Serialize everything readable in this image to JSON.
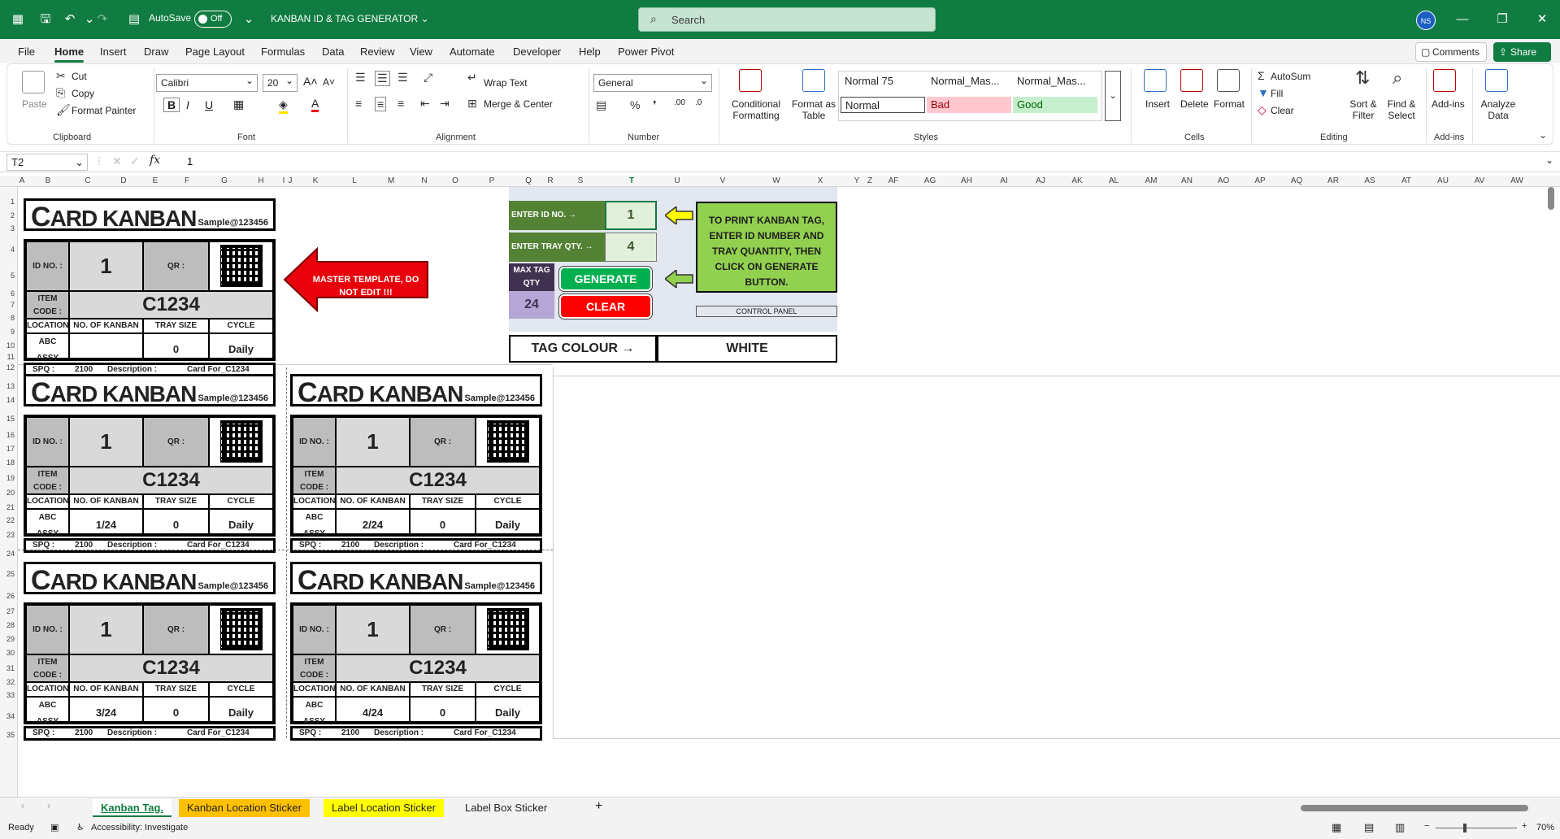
{
  "app": {
    "autosave_label": "AutoSave",
    "autosave_state": "Off",
    "doc_title": "KANBAN ID & TAG GENERATOR",
    "search_placeholder": "Search",
    "user_initials": "NS",
    "comments": "Comments",
    "share": "Share"
  },
  "menu": [
    "File",
    "Home",
    "Insert",
    "Draw",
    "Page Layout",
    "Formulas",
    "Data",
    "Review",
    "View",
    "Automate",
    "Developer",
    "Help",
    "Power Pivot"
  ],
  "ribbon": {
    "clipboard": {
      "paste": "Paste",
      "cut": "Cut",
      "copy": "Copy",
      "format_painter": "Format Painter",
      "group": "Clipboard"
    },
    "font": {
      "name": "Calibri",
      "size": "20",
      "group": "Font"
    },
    "alignment": {
      "wrap": "Wrap Text",
      "merge": "Merge & Center",
      "group": "Alignment"
    },
    "number": {
      "format": "General",
      "group": "Number"
    },
    "styles": {
      "conditional": "Conditional Formatting",
      "format_table": "Format as Table",
      "normal75": "Normal 75",
      "normal_mas1": "Normal_Mas...",
      "normal_mas2": "Normal_Mas...",
      "normal": "Normal",
      "bad": "Bad",
      "good": "Good",
      "group": "Styles"
    },
    "cells": {
      "insert": "Insert",
      "delete": "Delete",
      "format": "Format",
      "group": "Cells"
    },
    "editing": {
      "autosum": "AutoSum",
      "fill": "Fill",
      "clear": "Clear",
      "sort": "Sort & Filter",
      "find": "Find & Select",
      "group": "Editing"
    },
    "addins": {
      "addins": "Add-ins",
      "analyze": "Analyze Data",
      "group": "Add-ins"
    }
  },
  "formula": {
    "cell": "T2",
    "value": "1"
  },
  "columns": [
    "A",
    "B",
    "C",
    "D",
    "E",
    "F",
    "G",
    "H",
    "I",
    "J",
    "K",
    "L",
    "M",
    "N",
    "O",
    "P",
    "Q",
    "R",
    "S",
    "T",
    "U",
    "V",
    "W",
    "X",
    "Y",
    "Z",
    "AF",
    "AG",
    "AH",
    "AI",
    "AJ",
    "AK",
    "AL",
    "AM",
    "AN",
    "AO",
    "AP",
    "AQ",
    "AR",
    "AS",
    "AT",
    "AU",
    "AV",
    "AW"
  ],
  "rows": [
    "1",
    "2",
    "3",
    "4",
    "5",
    "6",
    "7",
    "8",
    "9",
    "10",
    "11",
    "12",
    "13",
    "14",
    "15",
    "16",
    "17",
    "18",
    "19",
    "20",
    "21",
    "22",
    "23",
    "24",
    "25",
    "26",
    "27",
    "28",
    "29",
    "30",
    "31",
    "32",
    "33",
    "34",
    "35"
  ],
  "card_common": {
    "title_rest": "ARD KANBAN",
    "title_first": "C",
    "sample": "Sample@123456",
    "id_label": "ID NO. :",
    "id_value": "1",
    "qr_label": "QR :",
    "item_label": "ITEM CODE :",
    "item_value": "C1234",
    "h_location": "LOCATION",
    "h_no": "NO. OF KANBAN",
    "h_tray": "TRAY SIZE",
    "h_cycle": "CYCLE",
    "loc_value": "ABC ASSY",
    "tray_value": "0",
    "cycle_value": "Daily",
    "spq_label": "SPQ :",
    "spq_value": "2100",
    "desc_label": "Description :",
    "desc_value": "Card For_C1234"
  },
  "cards": [
    {
      "no_kanban": ""
    },
    {
      "no_kanban": "1/24"
    },
    {
      "no_kanban": "2/24"
    },
    {
      "no_kanban": "3/24"
    },
    {
      "no_kanban": "4/24"
    }
  ],
  "master_note": "MASTER TEMPLATE, DO NOT EDIT !!!",
  "control": {
    "enter_id": "ENTER ID NO. →",
    "id_value": "1",
    "enter_tray": "ENTER TRAY QTY. →",
    "tray_value": "4",
    "max_label": "MAX TAG QTY",
    "max_value": "24",
    "generate": "GENERATE",
    "clear": "CLEAR",
    "instruction": "TO PRINT KANBAN TAG, ENTER ID NUMBER AND TRAY QUANTITY, THEN CLICK ON GENERATE BUTTON.",
    "panel_label": "CONTROL PANEL",
    "tag_colour_label": "TAG COLOUR →",
    "tag_colour_value": "WHITE"
  },
  "sheets": [
    "Kanban Tag.",
    "Kanban Location Sticker",
    "Label Location Sticker",
    "Label Box Sticker"
  ],
  "status": {
    "ready": "Ready",
    "accessibility": "Accessibility: Investigate",
    "zoom": "70%"
  }
}
